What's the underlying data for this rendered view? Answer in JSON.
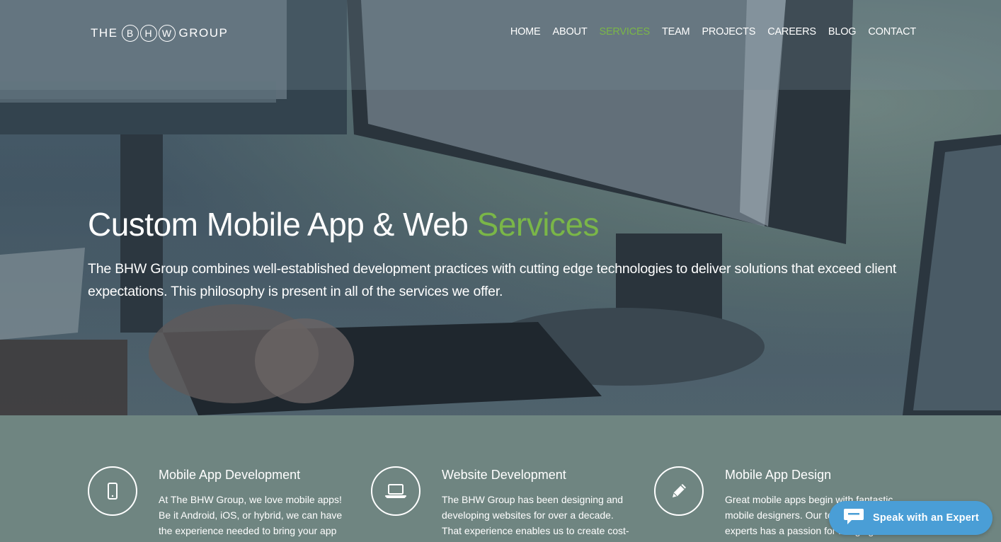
{
  "header": {
    "logo": {
      "pre": "THE",
      "letters": [
        "B",
        "H",
        "W"
      ],
      "post": "GROUP"
    },
    "nav": [
      {
        "label": "HOME",
        "active": false
      },
      {
        "label": "ABOUT",
        "active": false
      },
      {
        "label": "SERVICES",
        "active": true
      },
      {
        "label": "TEAM",
        "active": false
      },
      {
        "label": "PROJECTS",
        "active": false
      },
      {
        "label": "CAREERS",
        "active": false
      },
      {
        "label": "BLOG",
        "active": false
      },
      {
        "label": "CONTACT",
        "active": false
      }
    ]
  },
  "hero": {
    "title_main": "Custom Mobile App & Web ",
    "title_accent": "Services",
    "description": "The BHW Group combines well-established development practices with cutting edge technologies to deliver solutions that exceed client expectations. This philosophy is present in all of the services we offer."
  },
  "services": [
    {
      "icon": "mobile-phone-icon",
      "title": "Mobile App Development",
      "text": "At The BHW Group, we love mobile apps! Be it Android, iOS, or hybrid, we can have the experience needed to bring your app"
    },
    {
      "icon": "laptop-icon",
      "title": "Website Development",
      "text": "The BHW Group has been designing and developing websites for over a decade. That experience enables us to create cost-"
    },
    {
      "icon": "pencil-icon",
      "title": "Mobile App Design",
      "text": "Great mobile apps begin with fantastic mobile designers. Our team of design experts has a passion for bringing"
    }
  ],
  "chat": {
    "label": "Speak with an Expert",
    "icon": "chat-bubble-icon"
  },
  "colors": {
    "accent": "#7ab648",
    "chat": "#4a9ed6",
    "services_bg": "#6f8581"
  }
}
